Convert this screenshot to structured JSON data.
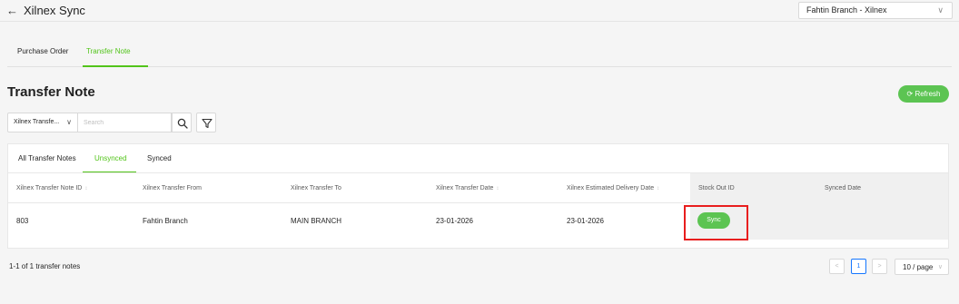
{
  "header": {
    "back_icon": "←",
    "title": "Xilnex Sync",
    "branch_selector": {
      "value": "Fahtin Branch - Xilnex",
      "chevron": "∨"
    }
  },
  "page_tabs": [
    {
      "label": "Purchase Order",
      "active": false
    },
    {
      "label": "Transfer Note",
      "active": true
    }
  ],
  "page": {
    "title": "Transfer Note",
    "refresh_label": "⟳ Refresh"
  },
  "filters": {
    "field_select": {
      "value": "Xilnex Transfe...",
      "chevron": "∨"
    },
    "search_placeholder": "Search",
    "search_icon": "search-icon",
    "filter_icon": "filter-icon"
  },
  "table_tabs": [
    {
      "label": "All Transfer Notes",
      "active": false
    },
    {
      "label": "Unsynced",
      "active": true
    },
    {
      "label": "Synced",
      "active": false
    }
  ],
  "table": {
    "columns": [
      {
        "label": "Xilnex Transfer Note ID",
        "sortable": true
      },
      {
        "label": "Xilnex Transfer From",
        "sortable": false
      },
      {
        "label": "Xilnex Transfer To",
        "sortable": false
      },
      {
        "label": "Xilnex Transfer Date",
        "sortable": true
      },
      {
        "label": "Xilnex Estimated Delivery Date",
        "sortable": true
      },
      {
        "label": "Stock Out ID",
        "sortable": false
      },
      {
        "label": "Synced Date",
        "sortable": false
      }
    ],
    "sort_icon": "↕",
    "rows": [
      {
        "note_id": "803",
        "transfer_from": "Fahtin Branch",
        "transfer_to": "MAIN BRANCH",
        "transfer_date": "23-01-2026",
        "estimated_delivery_date": "23-01-2026",
        "action_label": "Sync",
        "synced_date": ""
      }
    ]
  },
  "pagination": {
    "summary": "1-1 of 1 transfer notes",
    "prev": "<",
    "current_page": "1",
    "next": ">",
    "page_size": "10 / page",
    "page_size_chevron": "∨"
  },
  "colors": {
    "accent": "#52c41a",
    "button_green": "#5cc452",
    "highlight": "#e81e1e",
    "page_active": "#1677ff"
  }
}
